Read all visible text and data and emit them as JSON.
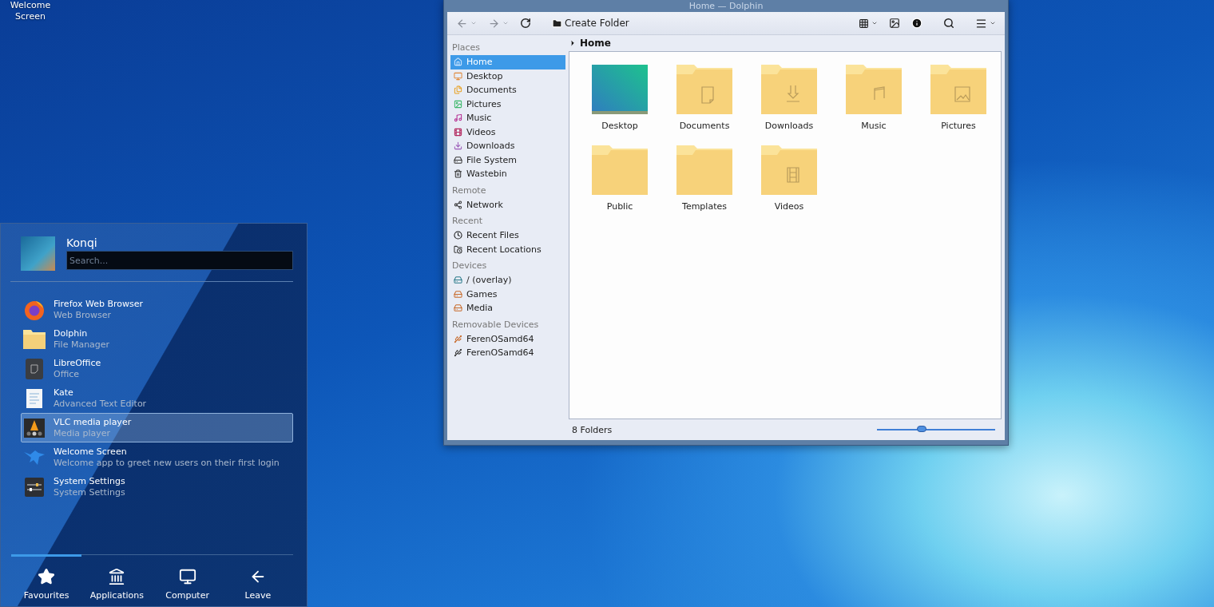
{
  "desktop": {
    "icons": [
      {
        "label": "Welcome Screen"
      }
    ]
  },
  "dolphin": {
    "title": "Home — Dolphin",
    "toolbar": {
      "back": {
        "disabled": true
      },
      "forward": {
        "disabled": true
      },
      "create_folder": "Create Folder"
    },
    "sidebar": [
      {
        "heading": "Places",
        "items": [
          {
            "label": "Home",
            "selected": true
          },
          {
            "label": "Desktop",
            "selected": false
          },
          {
            "label": "Documents",
            "selected": false
          },
          {
            "label": "Pictures",
            "selected": false
          },
          {
            "label": "Music",
            "selected": false
          },
          {
            "label": "Videos",
            "selected": false
          },
          {
            "label": "Downloads",
            "selected": false
          },
          {
            "label": "File System",
            "selected": false
          },
          {
            "label": "Wastebin",
            "selected": false
          }
        ]
      },
      {
        "heading": "Remote",
        "items": [
          {
            "label": "Network",
            "selected": false
          }
        ]
      },
      {
        "heading": "Recent",
        "items": [
          {
            "label": "Recent Files",
            "selected": false
          },
          {
            "label": "Recent Locations",
            "selected": false
          }
        ]
      },
      {
        "heading": "Devices",
        "items": [
          {
            "label": "/ (overlay)",
            "selected": false
          },
          {
            "label": "Games",
            "selected": false
          },
          {
            "label": "Media",
            "selected": false
          }
        ]
      },
      {
        "heading": "Removable Devices",
        "items": [
          {
            "label": "FerenOSamd64",
            "selected": false
          },
          {
            "label": "FerenOSamd64",
            "selected": false
          }
        ]
      }
    ],
    "breadcrumb": "Home",
    "files": [
      {
        "name": "Desktop",
        "kind": "thumbnail"
      },
      {
        "name": "Documents",
        "kind": "folder"
      },
      {
        "name": "Downloads",
        "kind": "folder"
      },
      {
        "name": "Music",
        "kind": "folder"
      },
      {
        "name": "Pictures",
        "kind": "folder"
      },
      {
        "name": "Public",
        "kind": "folder"
      },
      {
        "name": "Templates",
        "kind": "folder"
      },
      {
        "name": "Videos",
        "kind": "folder"
      }
    ],
    "status_bar": {
      "text": "8 Folders",
      "zoom": {
        "level": 0.38
      }
    }
  },
  "launcher": {
    "user": "Konqi",
    "search": {
      "placeholder": "Search..."
    },
    "apps": [
      {
        "name": "Firefox Web Browser",
        "description": "Web Browser",
        "selected": false
      },
      {
        "name": "Dolphin",
        "description": "File Manager",
        "selected": false
      },
      {
        "name": "LibreOffice",
        "description": "Office",
        "selected": false
      },
      {
        "name": "Kate",
        "description": "Advanced Text Editor",
        "selected": false
      },
      {
        "name": "VLC media player",
        "description": "Media player",
        "selected": true
      },
      {
        "name": "Welcome Screen",
        "description": "Welcome app to greet new users on their first login",
        "selected": false
      },
      {
        "name": "System Settings",
        "description": "System Settings",
        "selected": false
      }
    ],
    "tabs": [
      {
        "label": "Favourites",
        "selected": true
      },
      {
        "label": "Applications",
        "selected": false
      },
      {
        "label": "Computer",
        "selected": false
      },
      {
        "label": "Leave",
        "selected": false
      }
    ]
  }
}
